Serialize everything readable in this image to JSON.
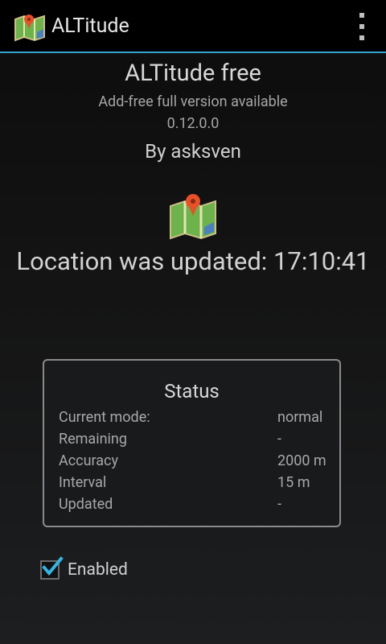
{
  "actionbar": {
    "title": "ALTitude"
  },
  "main": {
    "app_name": "ALTitude free",
    "promo": "Add-free full version available",
    "version": "0.12.0.0",
    "author": "By asksven",
    "location_text": "Location was updated: 17:10:41"
  },
  "status": {
    "title": "Status",
    "rows": [
      {
        "label": "Current mode:",
        "value": "normal"
      },
      {
        "label": "Remaining",
        "value": "-"
      },
      {
        "label": "Accuracy",
        "value": "2000 m"
      },
      {
        "label": "Interval",
        "value": "15 m"
      },
      {
        "label": "Updated",
        "value": "-"
      }
    ]
  },
  "enabled": {
    "label": "Enabled",
    "checked": true
  },
  "colors": {
    "accent": "#33a3cf",
    "pin": "#e8502a"
  }
}
